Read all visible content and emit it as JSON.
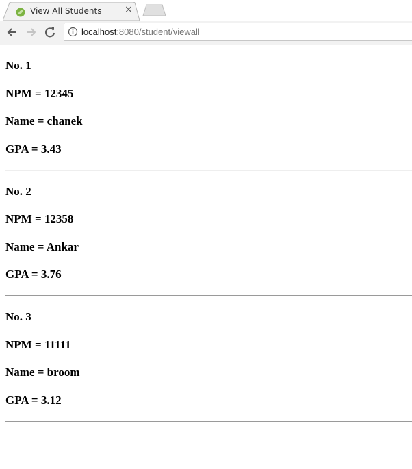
{
  "browser": {
    "tab_title": "View All Students",
    "tab_close": "×",
    "url_host": "localhost",
    "url_rest": ":8080/student/viewall"
  },
  "students": [
    {
      "no": "No. 1",
      "npm": "NPM = 12345",
      "name": "Name = chanek",
      "gpa": "GPA = 3.43"
    },
    {
      "no": "No. 2",
      "npm": "NPM = 12358",
      "name": "Name = Ankar",
      "gpa": "GPA = 3.76"
    },
    {
      "no": "No. 3",
      "npm": "NPM = 11111",
      "name": "Name = broom",
      "gpa": "GPA = 3.12"
    }
  ]
}
